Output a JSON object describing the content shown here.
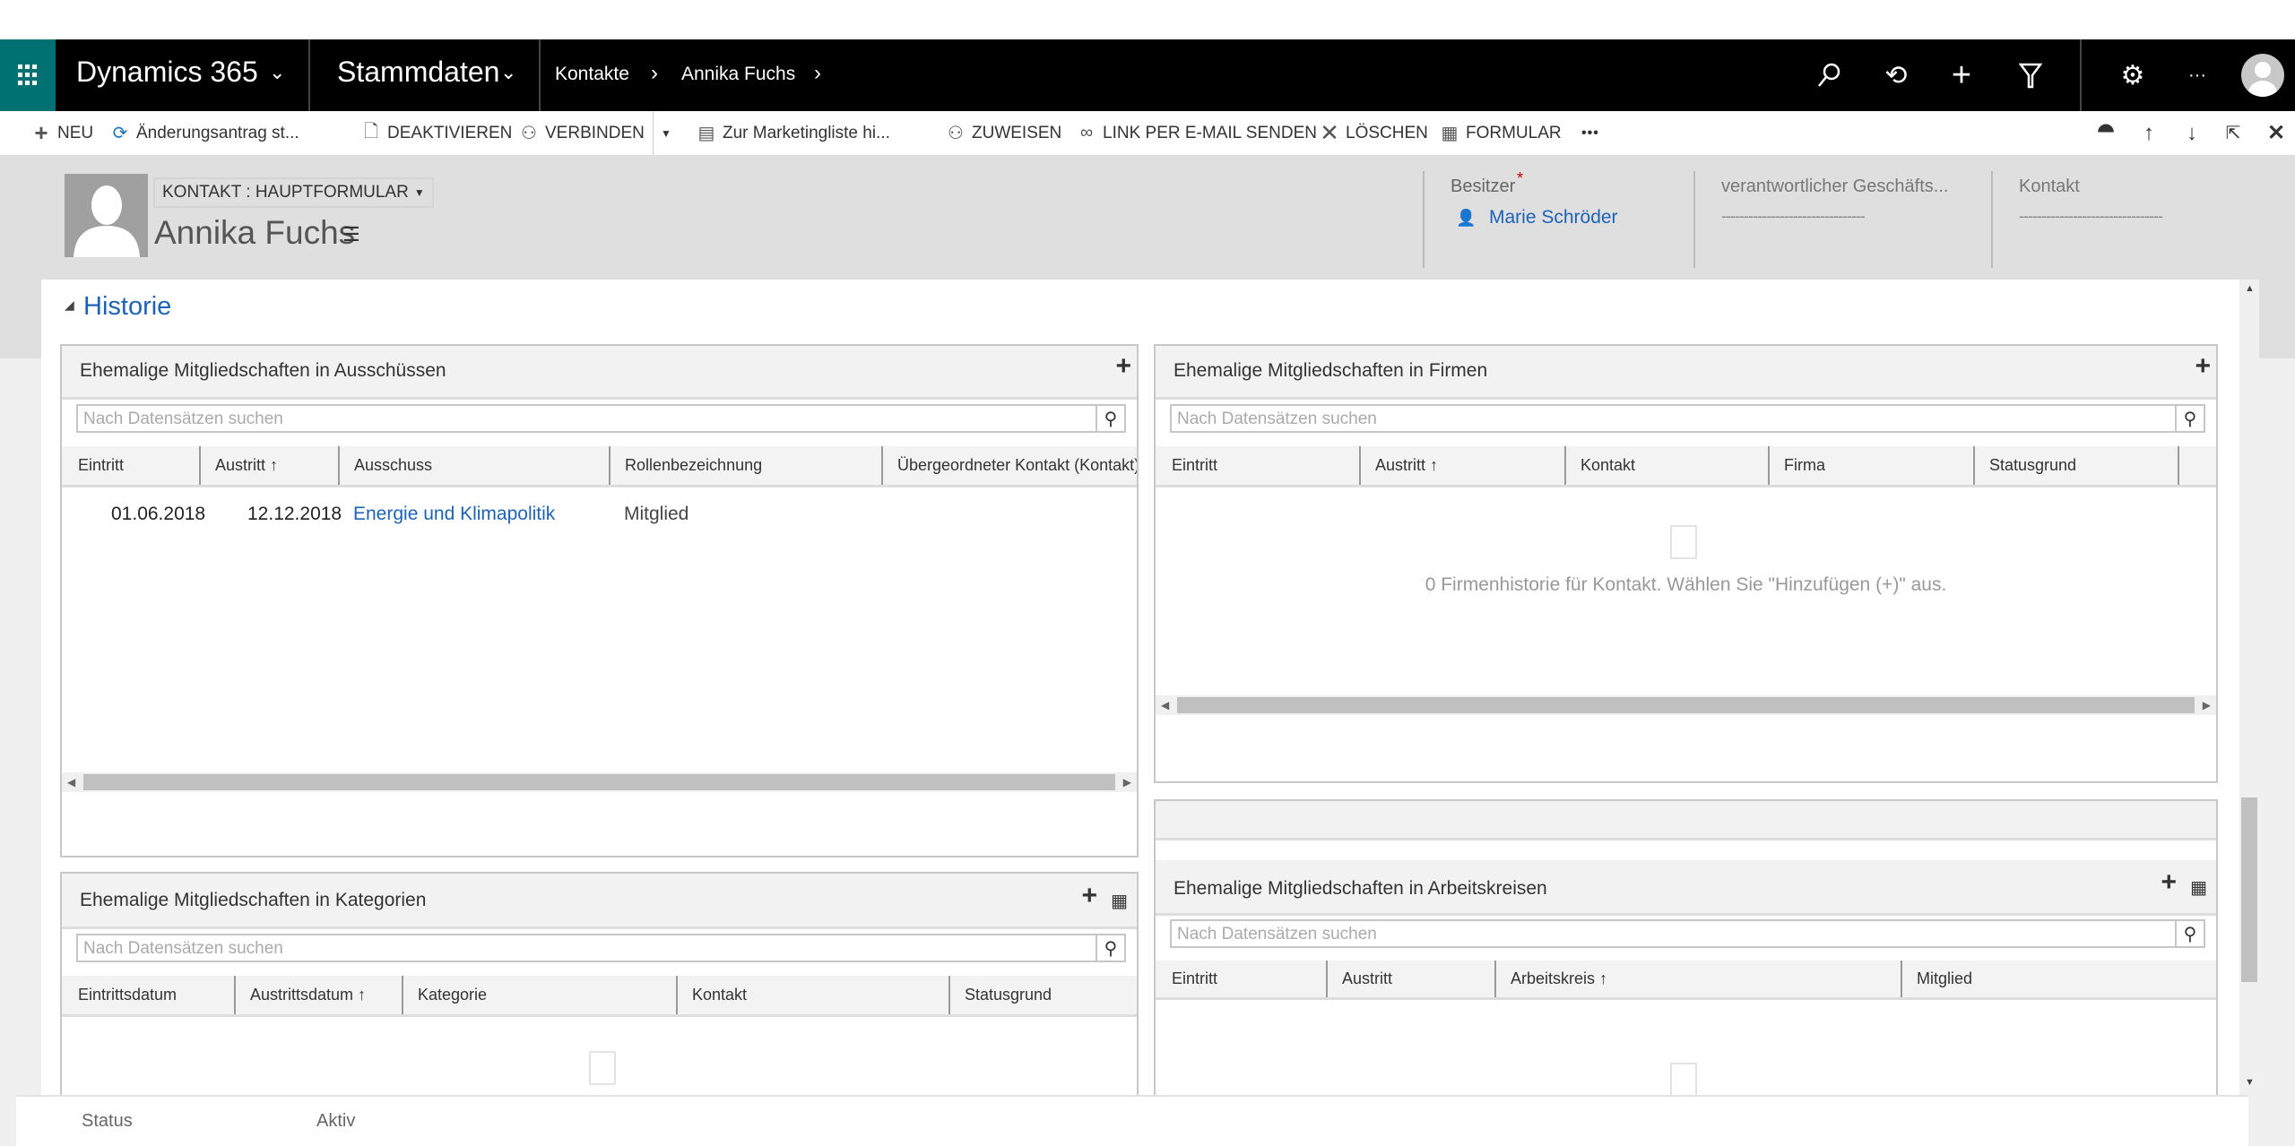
{
  "nav": {
    "app_name": "Dynamics 365",
    "area": "Stammdaten",
    "breadcrumb": [
      "Kontakte",
      "Annika Fuchs"
    ],
    "icons": [
      "search-icon",
      "history-icon",
      "plus-icon",
      "filter-icon",
      "gear-icon",
      "more-icon",
      "user-avatar-icon"
    ],
    "accent": "#007173"
  },
  "commands": {
    "items": [
      "Neu",
      "Änderungsantrag st...",
      "Deaktivieren",
      "Verbinden",
      "Zur Marketingliste hi...",
      "Zuweisen",
      "Link per E-Mail senden",
      "Löschen",
      "Formular"
    ],
    "more": "•••"
  },
  "header": {
    "form_selector": "KONTAKT : HAUPTFORMULAR",
    "record_name": "Annika Fuchs",
    "fields": [
      {
        "label": "Besitzer",
        "required": "*",
        "value": "Marie Schröder"
      },
      {
        "label": "verantwortlicher Geschäfts...",
        "value": "--------------------------------"
      },
      {
        "label": "Kontakt",
        "value": "--------------------------------"
      }
    ]
  },
  "section": {
    "title": "Historie"
  },
  "grids": {
    "committees": {
      "title": "Ehemalige Mitgliedschaften in Ausschüssen",
      "search_placeholder": "Nach Datensätzen suchen",
      "columns": [
        "Eintritt",
        "Austritt ↑",
        "Ausschuss",
        "Rollenbezeichnung",
        "Übergeordneter Kontakt (Kontakt)"
      ],
      "rows": [
        {
          "entry": "01.06.2018",
          "exit": "12.12.2018",
          "committee": "Energie und Klimapolitik",
          "role": "Mitglied"
        }
      ]
    },
    "companies": {
      "title": "Ehemalige Mitgliedschaften in Firmen",
      "search_placeholder": "Nach Datensätzen suchen",
      "columns": [
        "Eintritt",
        "Austritt ↑",
        "Kontakt",
        "Firma",
        "Statusgrund"
      ],
      "empty_message": "0 Firmenhistorie für Kontakt. Wählen Sie \"Hinzufügen (+)\" aus."
    },
    "categories": {
      "title": "Ehemalige Mitgliedschaften in Kategorien",
      "search_placeholder": "Nach Datensätzen suchen",
      "columns": [
        "Eintrittsdatum",
        "Austrittsdatum ↑",
        "Kategorie",
        "Kontakt",
        "Statusgrund"
      ]
    },
    "working_groups": {
      "title": "Ehemalige Mitgliedschaften in Arbeitskreisen",
      "search_placeholder": "Nach Datensätzen suchen",
      "columns": [
        "Eintritt",
        "Austritt",
        "Arbeitskreis ↑",
        "Mitglied"
      ]
    }
  },
  "footer": {
    "status_label": "Status",
    "status_value": "Aktiv"
  }
}
